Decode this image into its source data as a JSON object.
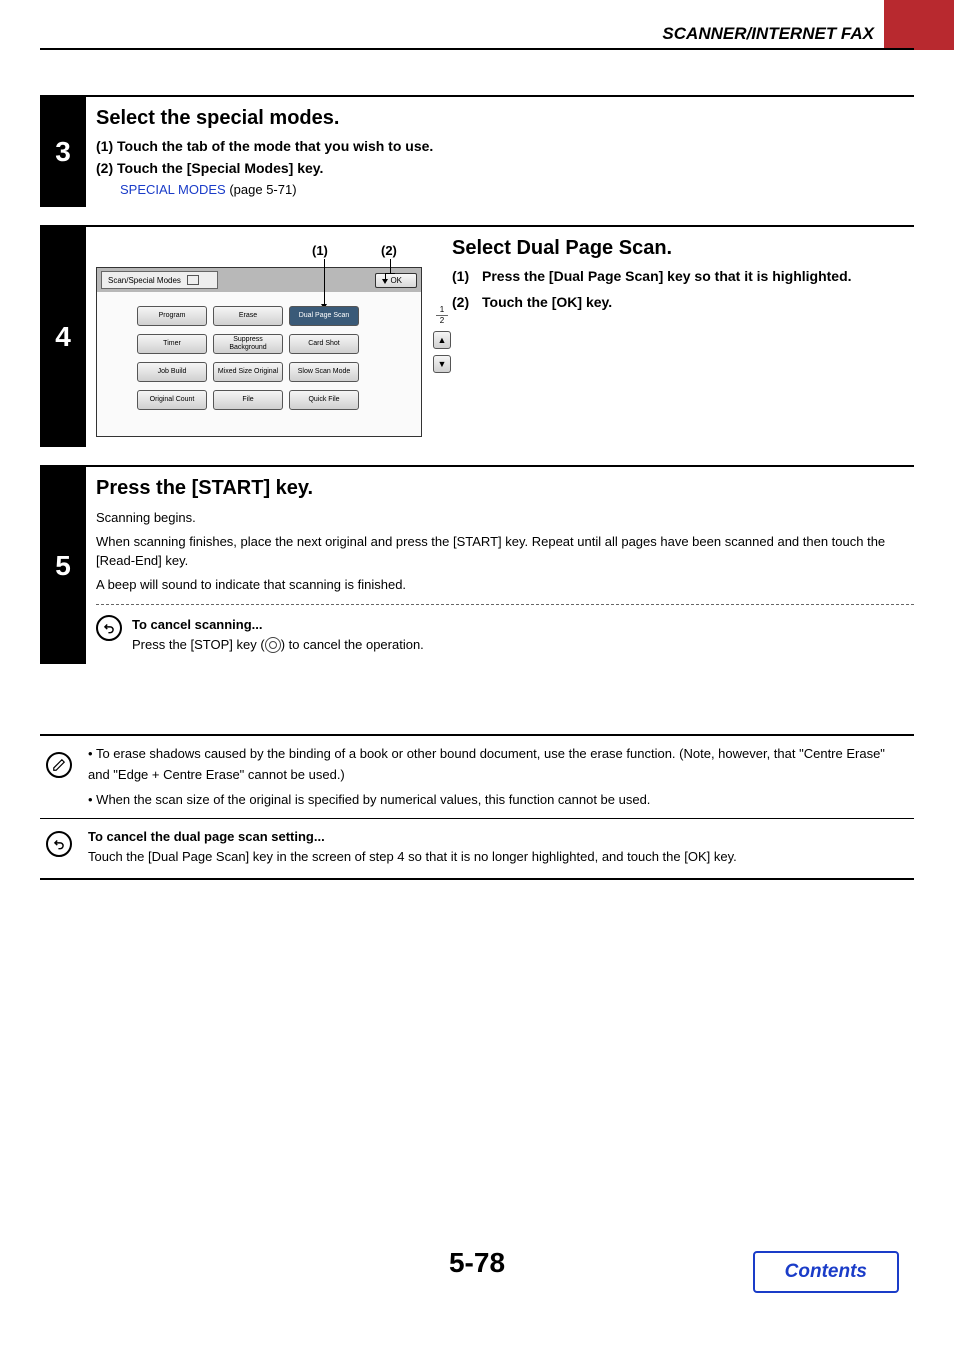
{
  "header": {
    "section_title": "SCANNER/INTERNET FAX"
  },
  "step3": {
    "number": "3",
    "title": "Select the special modes.",
    "line1": "(1)   Touch the tab of the mode that you wish to use.",
    "line2": "(2)   Touch the [Special Modes] key.",
    "link_text": "SPECIAL MODES",
    "link_suffix": " (page 5-71)"
  },
  "step4": {
    "number": "4",
    "callout1": "(1)",
    "callout2": "(2)",
    "screen": {
      "tab_label": "Scan/Special Modes",
      "ok": "OK",
      "buttons": {
        "program": "Program",
        "erase": "Erase",
        "dual_page": "Dual Page\nScan",
        "timer": "Timer",
        "suppress": "Suppress\nBackground",
        "card_shot": "Card Shot",
        "job_build": "Job\nBuild",
        "mixed_size": "Mixed Size\nOriginal",
        "slow_scan": "Slow Scan\nMode",
        "orig_count": "Original\nCount",
        "file": "File",
        "quick_file": "Quick File"
      },
      "page_top": "1",
      "page_bottom": "2"
    },
    "right": {
      "title": "Select Dual Page Scan.",
      "li1_num": "(1)",
      "li1_txt": "Press the [Dual Page Scan] key so that it is highlighted.",
      "li2_num": "(2)",
      "li2_txt": "Touch the [OK] key."
    }
  },
  "step5": {
    "number": "5",
    "title": "Press the [START] key.",
    "p1": "Scanning begins.",
    "p2": "When scanning finishes, place the next original and press the [START] key. Repeat until all pages have been scanned and then touch the [Read-End] key.",
    "p3": "A beep will sound to indicate that scanning is finished.",
    "cancel_title": "To cancel scanning...",
    "cancel_text_a": "Press the [STOP] key (",
    "cancel_text_b": ") to cancel the operation."
  },
  "info": {
    "bullet1": "To erase shadows caused by the binding of a book or other bound document, use the erase function. (Note, however, that \"Centre Erase\" and \"Edge + Centre Erase\" cannot be used.)",
    "bullet2": "When the scan size of the original is specified by numerical values, this function cannot be used."
  },
  "cancel_setting": {
    "title": "To cancel the dual page scan setting...",
    "text": "Touch the [Dual Page Scan] key in the screen of step 4 so that it is no longer highlighted, and touch the [OK] key."
  },
  "footer": {
    "page": "5-78",
    "contents": "Contents"
  }
}
